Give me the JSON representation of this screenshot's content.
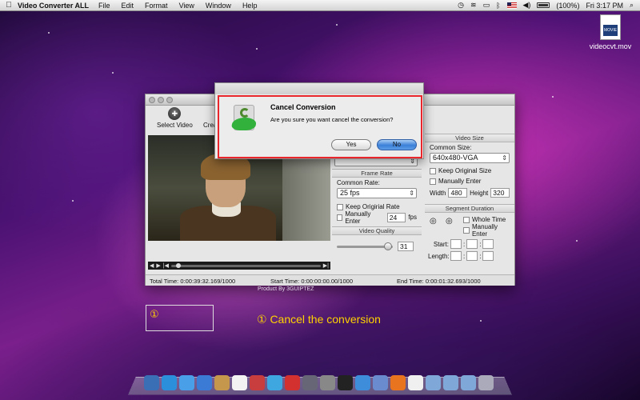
{
  "menubar": {
    "apple": "",
    "app_name": "Video Converter ALL",
    "menus": [
      "File",
      "Edit",
      "Format",
      "View",
      "Window",
      "Help"
    ],
    "battery": "(100%)",
    "clock": "Fri 3:17 PM"
  },
  "desktop": {
    "file_name": "videocvt.mov",
    "file_badge": "MOVIE"
  },
  "main_window": {
    "toolbar": {
      "select_video": "Select Video",
      "create": "Crea"
    },
    "video_size": {
      "header": "Video Size",
      "common_size_label": "Common Size:",
      "common_size_value": "640x480-VGA",
      "keep_original_size": "Keep Original Size",
      "manually_enter": "Manually Enter",
      "width_label": "Width",
      "width_value": "480",
      "height_label": "Height",
      "height_value": "320"
    },
    "frame_rate": {
      "header": "Frame Rate",
      "common_rate_label": "Common Rate:",
      "common_rate_value": "25 fps",
      "keep_original_rate": "Keep Origirial Rate",
      "manually_enter": "Manually Enter",
      "manual_value": "24",
      "unit": "fps"
    },
    "video_quality": {
      "header": "Video Quality",
      "value": "31",
      "fraction": 0.92
    },
    "segment_duration": {
      "header": "Segment Duration",
      "whole_time": "Whole Time",
      "manually_enter": "Manually Enter",
      "start_label": "Start:",
      "length_label": "Length:"
    },
    "status": {
      "total_time": "Total Time:   0:00:39:32.169/1000",
      "start_time": "Start Time:   0:00:00:00.00/1000",
      "end_time": "End Time:   0:00:01:32.693/1000"
    }
  },
  "dialog": {
    "title": "Cancel Conversion",
    "message": "Are you sure you want cancel the conversion?",
    "yes_label": "Yes",
    "no_label": "No"
  },
  "annotation": {
    "product_by": "Product By 3GUIPTEZ",
    "number": "①",
    "text": "① Cancel the conversion"
  },
  "colors": {
    "highlight": "#e8262b",
    "callout": "#ffd200",
    "primary_button": "#3b80d8"
  }
}
